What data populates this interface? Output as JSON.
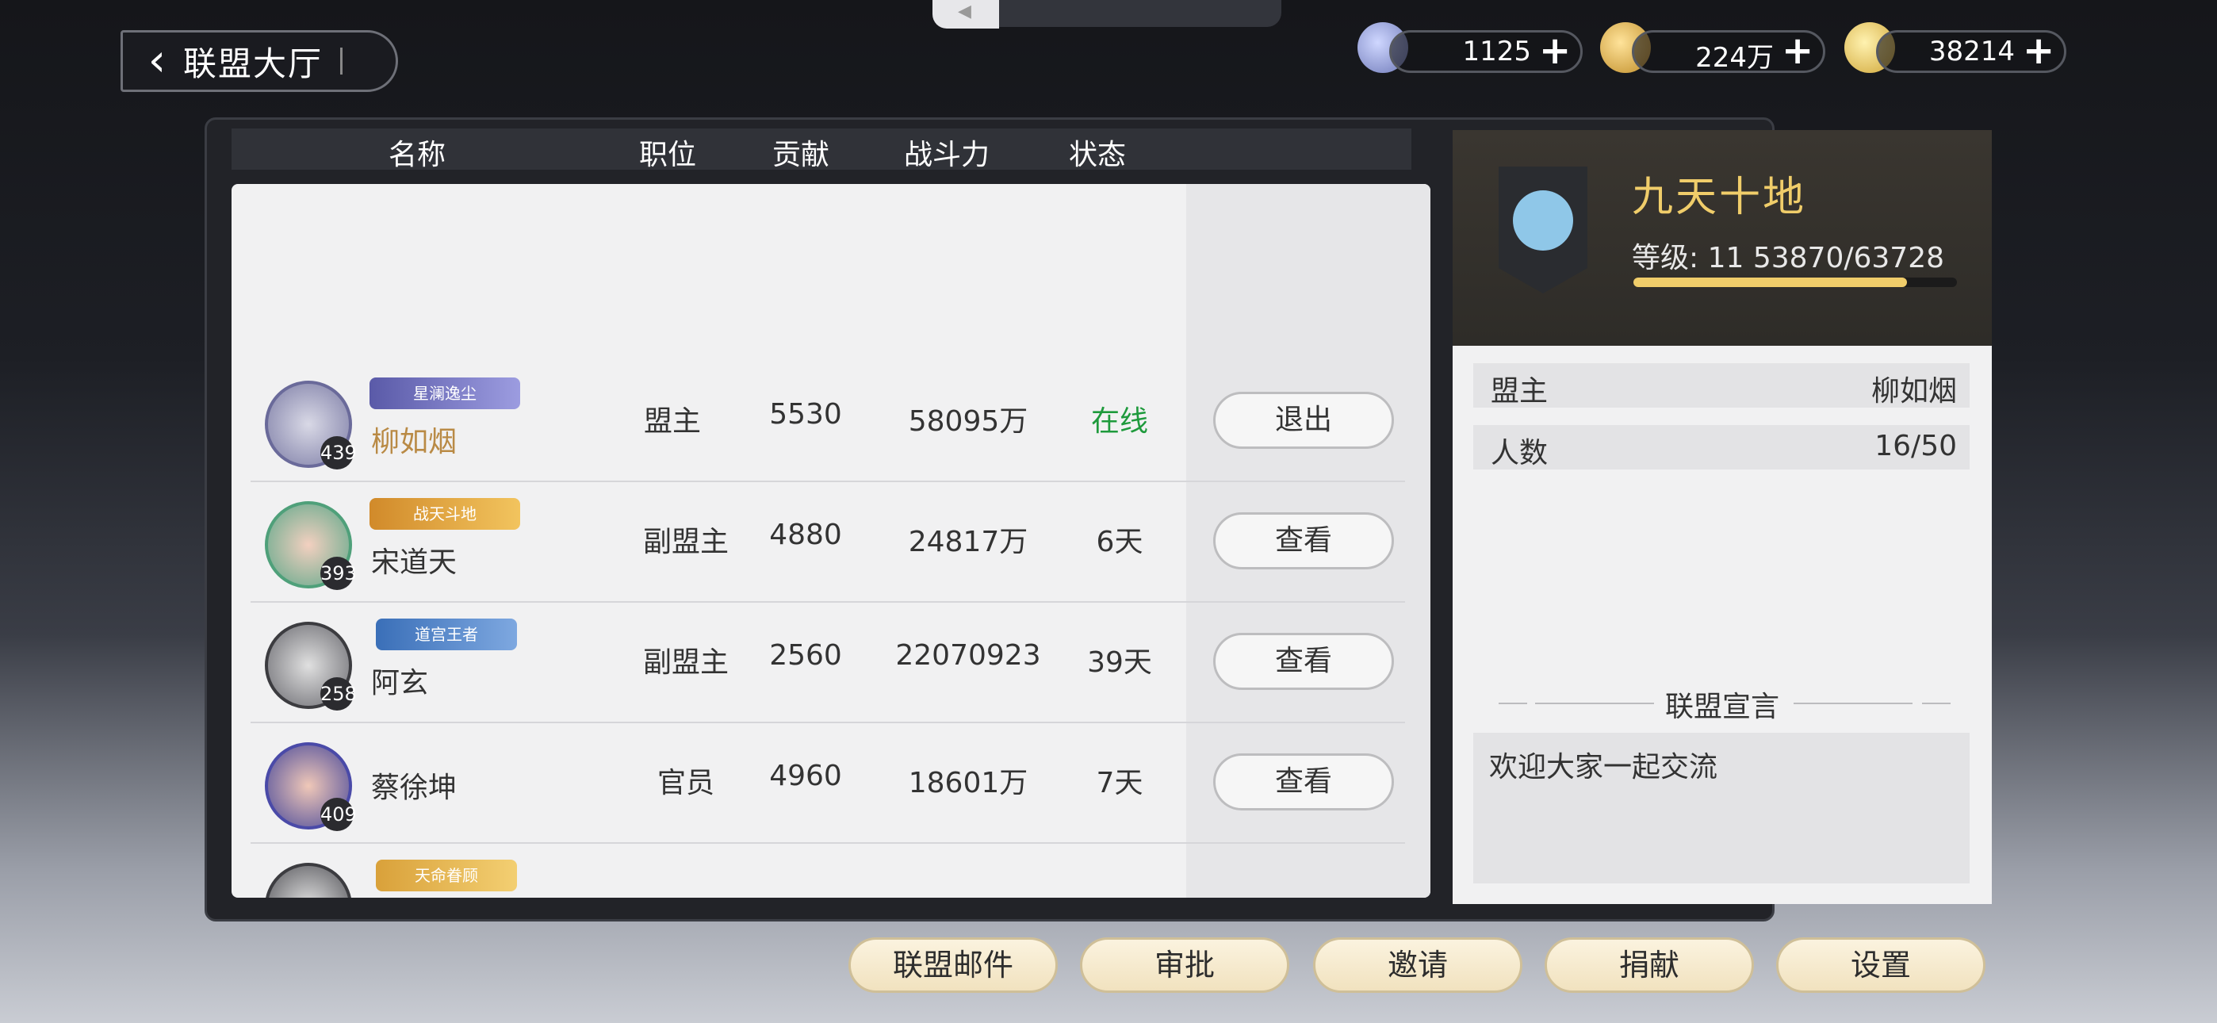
{
  "header": {
    "back_label": "联盟大厅"
  },
  "currencies": [
    {
      "icon": "dragon-token-icon",
      "value": "1125",
      "plus": "+"
    },
    {
      "icon": "coin-icon",
      "value": "224万",
      "plus": "+"
    },
    {
      "icon": "gourd-icon",
      "value": "38214",
      "plus": "+"
    }
  ],
  "table": {
    "columns": [
      "名称",
      "职位",
      "贡献",
      "战斗力",
      "状态"
    ],
    "rows": [
      {
        "badge": "星澜逸尘",
        "level": "439",
        "name": "柳如烟",
        "role": "盟主",
        "contribution": "5530",
        "power": "58095万",
        "status": "在线",
        "action": "退出"
      },
      {
        "badge": "战天斗地",
        "level": "393",
        "name": "宋道天",
        "role": "副盟主",
        "contribution": "4880",
        "power": "24817万",
        "status": "6天",
        "action": "查看"
      },
      {
        "badge": "道宫王者",
        "level": "258",
        "name": "阿玄",
        "role": "副盟主",
        "contribution": "2560",
        "power": "22070923",
        "status": "39天",
        "action": "查看"
      },
      {
        "badge": "",
        "level": "409",
        "name": "蔡徐坤",
        "role": "官员",
        "contribution": "4960",
        "power": "18601万",
        "status": "7天",
        "action": "查看"
      },
      {
        "badge": "天命眷顾",
        "level": "",
        "name": "",
        "role": "",
        "contribution": "",
        "power": "",
        "status": "",
        "action": ""
      }
    ]
  },
  "guild": {
    "name": "九天十地",
    "level_text": "等级: 11  53870/63728",
    "xp_fraction": 0.845,
    "leader_label": "盟主",
    "leader_value": "柳如烟",
    "members_label": "人数",
    "members_value": "16/50",
    "declaration_title": "联盟宣言",
    "declaration_text": "欢迎大家一起交流"
  },
  "bottom_buttons": [
    "联盟邮件",
    "审批",
    "邀请",
    "捐献",
    "设置"
  ],
  "colors": {
    "online": "#1e9a3c",
    "gold": "#f0cd6a",
    "leader_name": "#b98a45"
  }
}
